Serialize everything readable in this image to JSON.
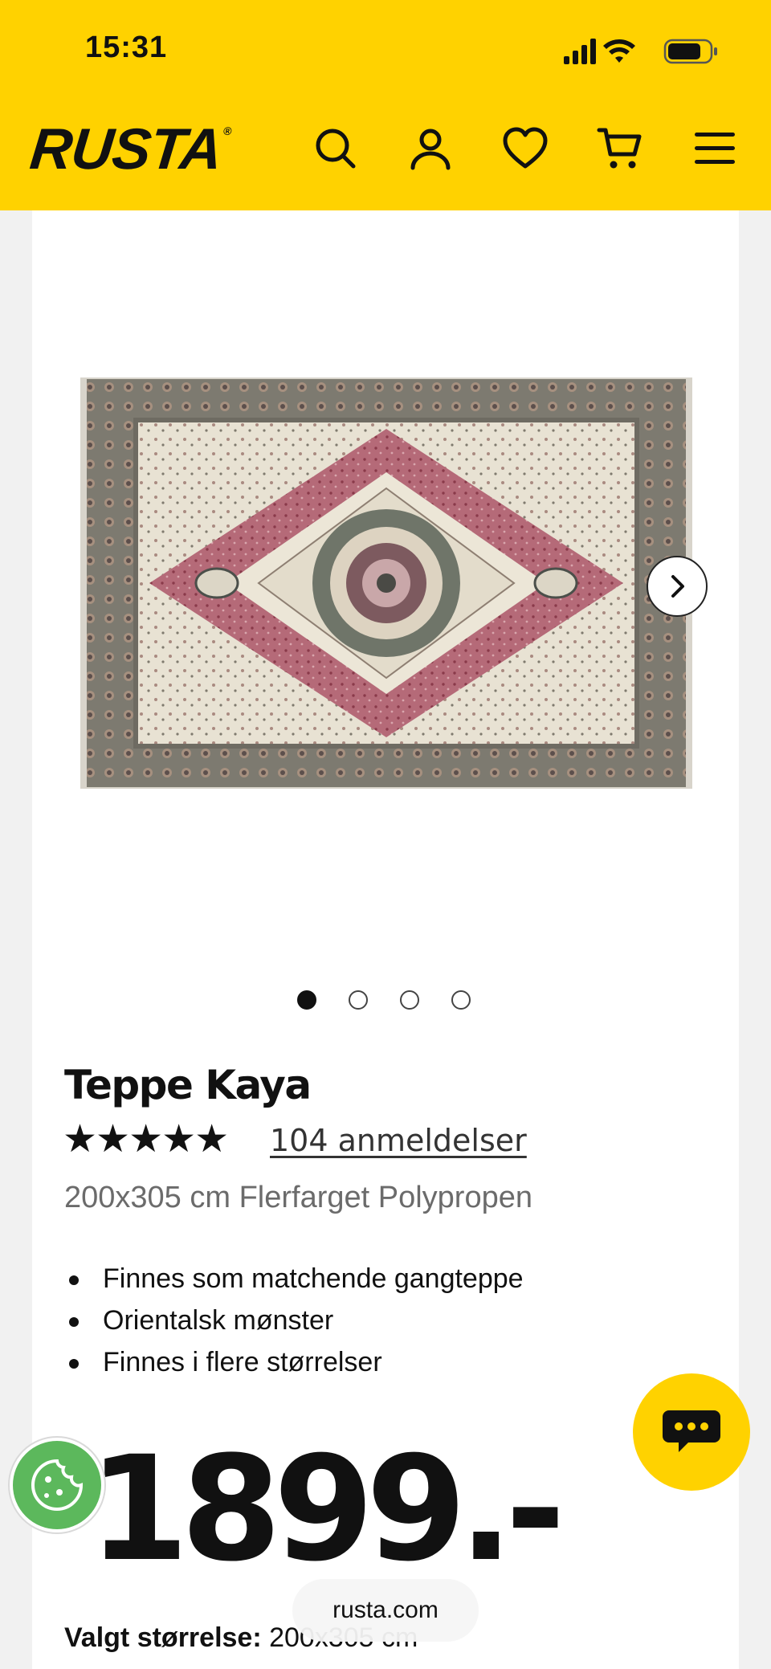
{
  "status_bar": {
    "time": "15:31"
  },
  "header": {
    "logo": "RUSTA",
    "icons": [
      "search-icon",
      "account-icon",
      "heart-icon",
      "cart-icon",
      "menu-icon"
    ],
    "background": "#ffd200"
  },
  "gallery": {
    "image_alt": "Teppe Kaya",
    "slide_count": 4,
    "active_index": 0
  },
  "product": {
    "title": "Teppe Kaya",
    "stars": "★★★★★",
    "rating": 5,
    "reviews": "104 anmeldelser",
    "subtitle": "200x305 cm Flerfarget Polypropen",
    "bullets": [
      "Finnes som matchende gangteppe",
      "Orientalsk mønster",
      "Finnes i flere størrelser"
    ],
    "price": "1899.-",
    "size_label": "Valgt størrelse:",
    "size_value": "200x305 cm"
  },
  "browser": {
    "url": "rusta.com"
  },
  "colors": {
    "brand_yellow": "#ffd200",
    "cookie_green": "#5cb85c"
  }
}
